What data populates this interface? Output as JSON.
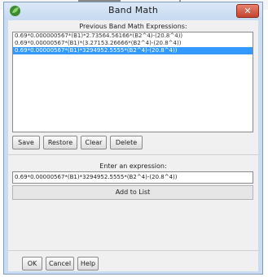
{
  "window": {
    "title": "Band Math",
    "close_label": "✕",
    "icon": "leaf-icon"
  },
  "previous": {
    "label": "Previous Band Math Expressions:",
    "items": [
      "0.69*0.000000567*(B1)*2.73564.56166*(B2^4)-(20.8^4))",
      "0.69*0.00000567*(B1)*(3.27153.26666*(B2^4)-(20.8^4))",
      "0.69*0.00000567*(B1)*3294952.5555*(B2^4)-(20.8^4))"
    ],
    "selected_index": 2
  },
  "list_buttons": {
    "save": "Save",
    "restore": "Restore",
    "clear": "Clear",
    "delete": "Delete"
  },
  "expression": {
    "label": "Enter an expression:",
    "value": "0.69*0.00000567*(B1)*3294952.5555*(B2^4)-(20.8^4))"
  },
  "add_to_list": "Add to List",
  "footer": {
    "ok": "OK",
    "cancel": "Cancel",
    "help": "Help"
  },
  "colors": {
    "titlebar": "#c7daf0",
    "selection": "#3399ff",
    "close": "#c4432d"
  }
}
